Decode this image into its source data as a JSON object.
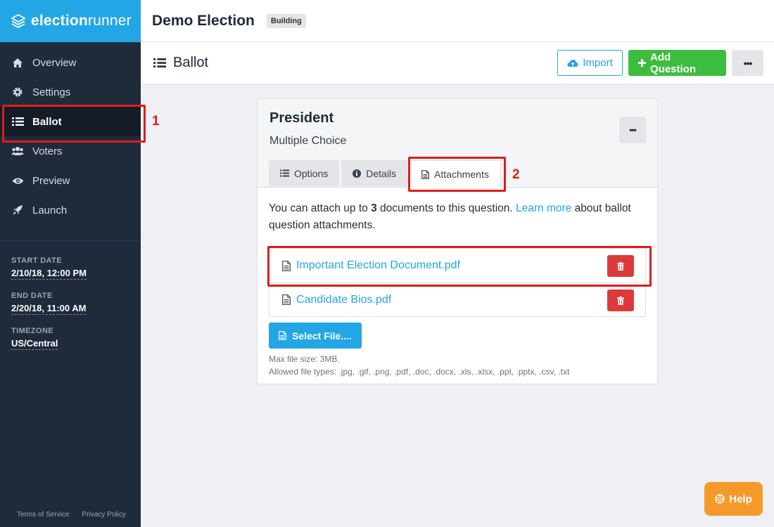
{
  "brand": {
    "bold": "election",
    "light": "runner"
  },
  "sidebar": {
    "items": [
      {
        "label": "Overview",
        "icon": "home-icon"
      },
      {
        "label": "Settings",
        "icon": "gear-icon"
      },
      {
        "label": "Ballot",
        "icon": "list-icon",
        "active": true
      },
      {
        "label": "Voters",
        "icon": "users-icon"
      },
      {
        "label": "Preview",
        "icon": "eye-icon"
      },
      {
        "label": "Launch",
        "icon": "rocket-icon"
      }
    ],
    "start_label": "START DATE",
    "start_value": "2/10/18, 12:00 PM",
    "end_label": "END DATE",
    "end_value": "2/20/18, 11:00 AM",
    "tz_label": "TIMEZONE",
    "tz_value": "US/Central",
    "footer": {
      "terms": "Terms of Service",
      "privacy": "Privacy Policy"
    }
  },
  "header": {
    "title": "Demo Election",
    "status": "Building"
  },
  "page": {
    "title": "Ballot",
    "import_label": "Import",
    "add_label": "Add Question",
    "more_label": "•••"
  },
  "question": {
    "title": "President",
    "type": "Multiple Choice",
    "more_label": "•••",
    "tabs": [
      {
        "label": "Options",
        "icon": "list-icon"
      },
      {
        "label": "Details",
        "icon": "info-icon"
      },
      {
        "label": "Attachments",
        "icon": "document-icon",
        "active": true
      }
    ]
  },
  "attachments": {
    "desc_pre": "You can attach up to ",
    "desc_count": "3",
    "desc_mid": " documents to this question. ",
    "desc_link": "Learn more",
    "desc_post": " about ballot question attachments.",
    "files": [
      {
        "name": "Important Election Document.pdf"
      },
      {
        "name": "Candidate Bios.pdf"
      }
    ],
    "select_label": "Select File....",
    "max_size": "Max file size: 3MB.",
    "allowed": "Allowed file types: .jpg, .gif, .png, .pdf, .doc, .docx, .xls, .xlsx, .ppt, .pptx, .csv, .txt"
  },
  "annotations": {
    "one": "1",
    "two": "2"
  },
  "help_label": "Help",
  "colors": {
    "sidebar": "#1f2a3a",
    "brand": "#22a6e6",
    "accent": "#22a6e6",
    "add": "#3dbd3d",
    "danger": "#dc3a3a",
    "highlight": "#e01b1b",
    "help": "#f59a2a"
  }
}
